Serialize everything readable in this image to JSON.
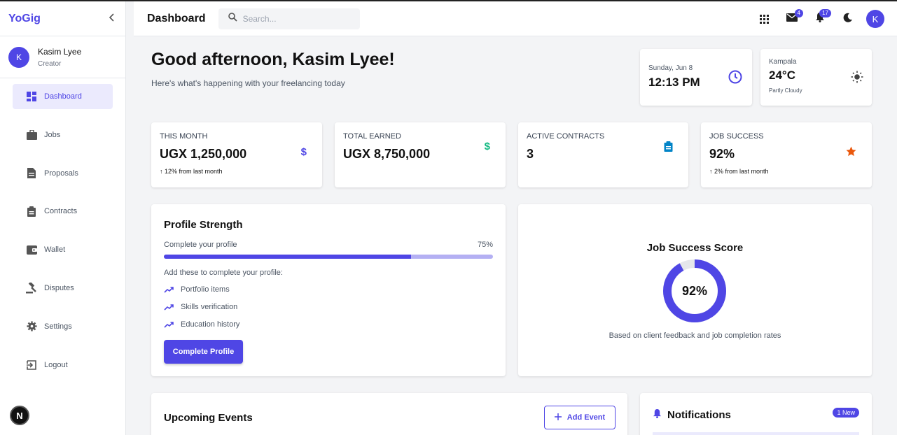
{
  "app": {
    "name": "YoGig"
  },
  "user": {
    "initial": "K",
    "name": "Kasim Lyee",
    "role": "Creator"
  },
  "sidebar": {
    "items": [
      {
        "label": "Dashboard",
        "icon": "dashboard-icon",
        "active": true
      },
      {
        "label": "Jobs",
        "icon": "briefcase-icon"
      },
      {
        "label": "Proposals",
        "icon": "document-icon"
      },
      {
        "label": "Contracts",
        "icon": "clipboard-icon"
      },
      {
        "label": "Wallet",
        "icon": "wallet-icon"
      },
      {
        "label": "Disputes",
        "icon": "gavel-icon"
      },
      {
        "label": "Settings",
        "icon": "gear-icon"
      },
      {
        "label": "Logout",
        "icon": "logout-icon"
      }
    ],
    "bottom_badge": "N"
  },
  "header": {
    "title": "Dashboard",
    "search_placeholder": "Search...",
    "mail_count": "4",
    "notif_count": "17",
    "avatar_initial": "K"
  },
  "greeting": {
    "title": "Good afternoon, Kasim Lyee!",
    "subtitle": "Here's what's happening with your freelancing today"
  },
  "datetime": {
    "date": "Sunday, Jun 8",
    "time": "12:13 PM"
  },
  "weather": {
    "city": "Kampala",
    "temp": "24°C",
    "condition": "Partly Cloudy"
  },
  "stats": [
    {
      "label": "THIS MONTH",
      "value": "UGX 1,250,000",
      "change": "↑ 12% from last month",
      "icon": "dollar-icon",
      "color": "#4f46e5"
    },
    {
      "label": "TOTAL EARNED",
      "value": "UGX 8,750,000",
      "change": "",
      "icon": "dollar-icon",
      "color": "#10b981"
    },
    {
      "label": "ACTIVE CONTRACTS",
      "value": "3",
      "change": "",
      "icon": "clipboard-icon",
      "color": "#0284c7"
    },
    {
      "label": "JOB SUCCESS",
      "value": "92%",
      "change": "↑ 2% from last month",
      "icon": "star-icon",
      "color": "#ea580c"
    }
  ],
  "profile": {
    "title": "Profile Strength",
    "progress_label": "Complete your profile",
    "progress_value": "75%",
    "progress_fraction": 0.75,
    "todo_title": "Add these to complete your profile:",
    "todos": [
      "Portfolio items",
      "Skills verification",
      "Education history"
    ],
    "button": "Complete Profile"
  },
  "job_success": {
    "title": "Job Success Score",
    "value": "92%",
    "fraction": 0.92,
    "caption": "Based on client feedback and job completion rates"
  },
  "events": {
    "title": "Upcoming Events",
    "button": "Add Event"
  },
  "notifications": {
    "title": "Notifications",
    "badge": "1 New"
  },
  "colors": {
    "accent": "#4f46e5",
    "accent_light": "#b4b0f3"
  }
}
